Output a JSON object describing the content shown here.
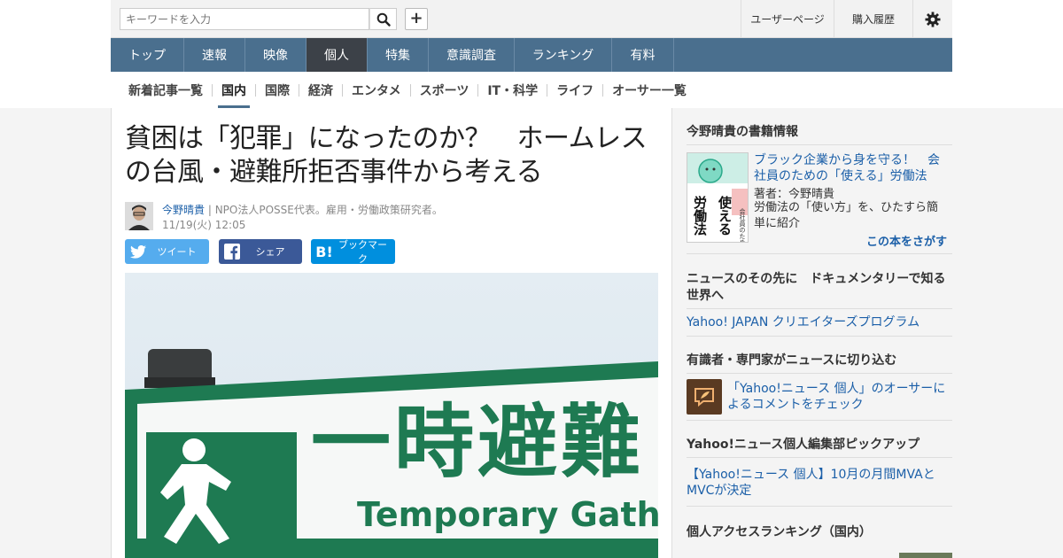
{
  "header": {
    "search_placeholder": "キーワードを入力",
    "plus_label": "+",
    "user_page": "ユーザーページ",
    "purchase_history": "購入履歴"
  },
  "main_nav": [
    {
      "label": "トップ",
      "active": false
    },
    {
      "label": "速報",
      "active": false
    },
    {
      "label": "映像",
      "active": false
    },
    {
      "label": "個人",
      "active": true
    },
    {
      "label": "特集",
      "active": false
    },
    {
      "label": "意識調査",
      "active": false
    },
    {
      "label": "ランキング",
      "active": false
    },
    {
      "label": "有料",
      "active": false
    }
  ],
  "sub_nav": [
    {
      "label": "新着記事一覧",
      "active": false
    },
    {
      "label": "国内",
      "active": true
    },
    {
      "label": "国際",
      "active": false
    },
    {
      "label": "経済",
      "active": false
    },
    {
      "label": "エンタメ",
      "active": false
    },
    {
      "label": "スポーツ",
      "active": false
    },
    {
      "label": "IT・科学",
      "active": false
    },
    {
      "label": "ライフ",
      "active": false
    },
    {
      "label": "オーサー一覧",
      "active": false
    }
  ],
  "article": {
    "title": "貧困は「犯罪」になったのか？　ホームレスの台風・避難所拒否事件から考える",
    "author": "今野晴貴",
    "author_desc": "| NPO法人POSSE代表。雇用・労働政策研究者。",
    "date": "11/19(火) 12:05",
    "share": {
      "tweet": "ツイート",
      "facebook": "シェア",
      "hatena": "ブックマーク"
    },
    "photo_sign": {
      "jp": "一時避難",
      "en": "Temporary Gathe"
    }
  },
  "sidebar": {
    "books_heading": "今野晴貴の書籍情報",
    "book_title": "ブラック企業から身を守る！　会社員のための「使える」労働法",
    "book_author": "著者：今野晴貴",
    "book_desc": "労働法の「使い方」を、ひたすら簡単に紹介",
    "book_find": "この本をさがす",
    "book_cover_lines": [
      "会社員のための",
      "使える",
      "労働法"
    ],
    "doc_heading": "ニュースのその先に　ドキュメンタリーで知る世界へ",
    "doc_link": "Yahoo! JAPAN クリエイターズプログラム",
    "expert_heading": "有識者・専門家がニュースに切り込む",
    "expert_link": "「Yahoo!ニュース 個人」のオーサーによるコメントをチェック",
    "pickup_heading": "Yahoo!ニュース個人編集部ピックアップ",
    "pickup_link": "【Yahoo!ニュース 個人】10月の月間MVAとMVCが決定",
    "ranking_heading": "個人アクセスランキング（国内）"
  },
  "colors": {
    "nav_bg": "#4a6f8e",
    "nav_active": "#3c4148",
    "link": "#1b5fa8",
    "twitter": "#55acee",
    "facebook": "#3b5998",
    "hatena": "#008fde",
    "sign_green": "#1e7a52"
  }
}
